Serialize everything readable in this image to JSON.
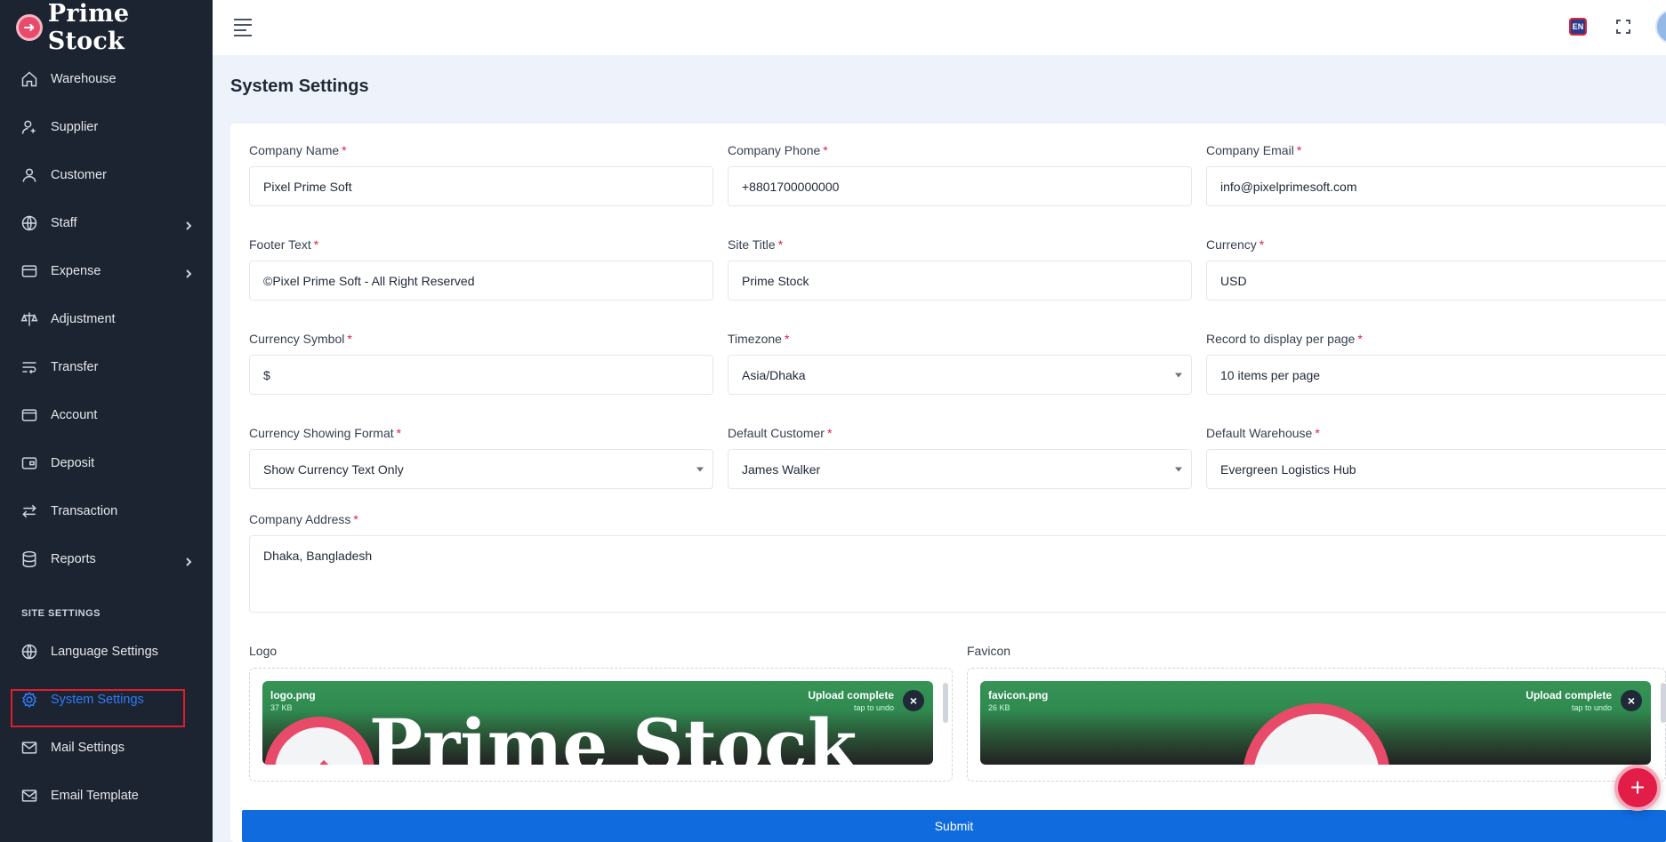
{
  "brand": {
    "name": "Prime Stock",
    "logo_icon": "prime-stock-logo-icon"
  },
  "sidebar": {
    "items": [
      {
        "label": "Warehouse",
        "icon": "home-icon",
        "has_submenu": false
      },
      {
        "label": "Supplier",
        "icon": "user-add-icon",
        "has_submenu": false
      },
      {
        "label": "Customer",
        "icon": "user-icon",
        "has_submenu": false
      },
      {
        "label": "Staff",
        "icon": "globe-icon",
        "has_submenu": true
      },
      {
        "label": "Expense",
        "icon": "card-icon",
        "has_submenu": true
      },
      {
        "label": "Adjustment",
        "icon": "scale-icon",
        "has_submenu": false
      },
      {
        "label": "Transfer",
        "icon": "transfer-icon",
        "has_submenu": false
      },
      {
        "label": "Account",
        "icon": "wallet-icon",
        "has_submenu": false
      },
      {
        "label": "Deposit",
        "icon": "deposit-icon",
        "has_submenu": false
      },
      {
        "label": "Transaction",
        "icon": "swap-icon",
        "has_submenu": false
      },
      {
        "label": "Reports",
        "icon": "database-icon",
        "has_submenu": true
      }
    ],
    "section_title": "SITE SETTINGS",
    "settings_items": [
      {
        "label": "Language Settings",
        "icon": "language-icon",
        "active": false
      },
      {
        "label": "System Settings",
        "icon": "gear-icon",
        "active": true
      },
      {
        "label": "Mail Settings",
        "icon": "mail-settings-icon",
        "active": false
      },
      {
        "label": "Email Template",
        "icon": "email-template-icon",
        "active": false
      }
    ],
    "active_color": "#2f7df6"
  },
  "topbar": {
    "language": "EN"
  },
  "page": {
    "title": "System Settings"
  },
  "form": {
    "company_name": {
      "label": "Company Name",
      "value": "Pixel Prime Soft"
    },
    "company_phone": {
      "label": "Company Phone",
      "value": "+8801700000000"
    },
    "company_email": {
      "label": "Company Email",
      "value": "info@pixelprimesoft.com"
    },
    "footer_text": {
      "label": "Footer Text",
      "value": "©Pixel Prime Soft - All Right Reserved"
    },
    "site_title": {
      "label": "Site Title",
      "value": "Prime Stock"
    },
    "currency": {
      "label": "Currency",
      "value": "USD"
    },
    "currency_symbol": {
      "label": "Currency Symbol",
      "value": "$"
    },
    "timezone": {
      "label": "Timezone",
      "value": "Asia/Dhaka"
    },
    "records_per_page": {
      "label": "Record to display per page",
      "value": "10 items per page"
    },
    "currency_format": {
      "label": "Currency Showing Format",
      "value": "Show Currency Text Only"
    },
    "default_customer": {
      "label": "Default Customer",
      "value": "James Walker"
    },
    "default_warehouse": {
      "label": "Default Warehouse",
      "value": "Evergreen Logistics Hub"
    },
    "company_address": {
      "label": "Company Address",
      "value": "Dhaka, Bangladesh"
    },
    "required_mark": "*",
    "logo": {
      "label": "Logo",
      "file_name": "logo.png",
      "file_size": "37 KB",
      "status": "Upload complete",
      "undo": "tap to undo",
      "preview_text": "Prime Stock"
    },
    "favicon": {
      "label": "Favicon",
      "file_name": "favicon.png",
      "file_size": "26 KB",
      "status": "Upload complete",
      "undo": "tap to undo"
    },
    "close_symbol": "×",
    "submit_label": "Submit"
  },
  "fab": {
    "label": "+"
  },
  "colors": {
    "primary": "#0f6bde",
    "sidebar_bg": "#1c2331",
    "required": "#e11d48",
    "upload_success": "#369457"
  }
}
